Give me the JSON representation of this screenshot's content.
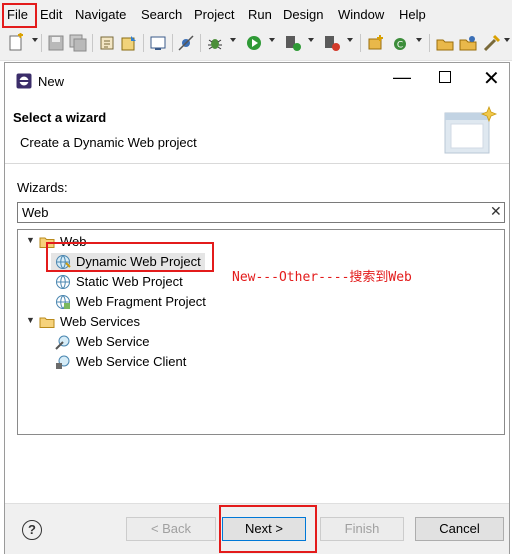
{
  "menubar": {
    "items": [
      "File",
      "Edit",
      "Navigate",
      "Search",
      "Project",
      "Run",
      "Design",
      "Window",
      "Help"
    ]
  },
  "dialog": {
    "title": "New",
    "heading": "Select a wizard",
    "description": "Create a Dynamic Web project",
    "wizards_label": "Wizards:",
    "filter_value": "Web",
    "tree": [
      {
        "label": "Web",
        "expanded": true,
        "children": [
          "Dynamic Web Project",
          "Static Web Project",
          "Web Fragment Project"
        ]
      },
      {
        "label": "Web Services",
        "expanded": true,
        "children": [
          "Web Service",
          "Web Service Client"
        ]
      }
    ],
    "annotation": "New---Other----搜索到Web",
    "buttons": {
      "back": "< Back",
      "next": "Next >",
      "finish": "Finish",
      "cancel": "Cancel"
    }
  },
  "colors": {
    "highlight": "#e31b1b",
    "annotation": "#e31b1b",
    "selection": "#e5e5e5"
  }
}
